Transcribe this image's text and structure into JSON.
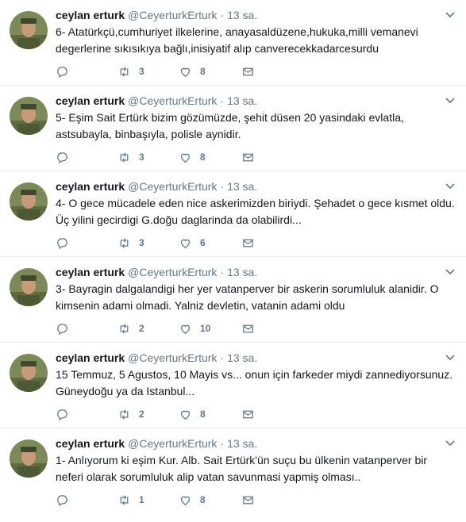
{
  "user": {
    "name": "ceylan erturk",
    "handle": "@CeyerturkErturk",
    "dot": "·"
  },
  "tweets": [
    {
      "time": "13 sa.",
      "text": "6- Atatürkçü,cumhuriyet ilkelerine, anayasaldüzene,hukuka,milli vemanevi degerlerine sıkısıkıya bağlı,inisiyatif alıp canverecekkadarcesurdu",
      "retweets": "3",
      "likes": "8"
    },
    {
      "time": "13 sa.",
      "text": "5- Eşim Sait Ertürk bizim gözümüzde, şehit düsen 20 yasindaki evlatla, astsubayla, binbaşıyla, polisle aynidir.",
      "retweets": "3",
      "likes": "8"
    },
    {
      "time": "13 sa.",
      "text": "4- O gece mücadele eden nice askerimizden biriydi. Şehadet o gece kısmet oldu. Üç yilini gecirdigi G.doğu daglarinda da olabilirdi...",
      "retweets": "3",
      "likes": "6"
    },
    {
      "time": "13 sa.",
      "text": "3- Bayragin dalgalandigi her yer vatanperver bir askerin sorumluluk alanidir. O kimsenin adami olmadi. Yalniz devletin, vatanin adami oldu",
      "retweets": "2",
      "likes": "10"
    },
    {
      "time": "13 sa.",
      "text": "15 Temmuz, 5 Agustos, 10 Mayis vs... onun için farkeder miydi zannediyorsunuz. Güneydoğu ya da Istanbul...",
      "retweets": "2",
      "likes": "8"
    },
    {
      "time": "13 sa.",
      "text": "1- Anlıyorum ki eşim Kur. Alb. Sait Ertürk'ün suçu bu ülkenin vatanperver bir neferi olarak sorumluluk alip vatan savunmasi yapmiş olması..",
      "retweets": "1",
      "likes": "8"
    }
  ],
  "icons": {
    "reply": "reply-icon",
    "retweet": "retweet-icon",
    "like": "heart-icon",
    "message": "envelope-icon",
    "caret": "chevron-down-icon"
  },
  "colors": {
    "text": "#14171a",
    "muted": "#657786",
    "divider": "#e6ecf0"
  }
}
